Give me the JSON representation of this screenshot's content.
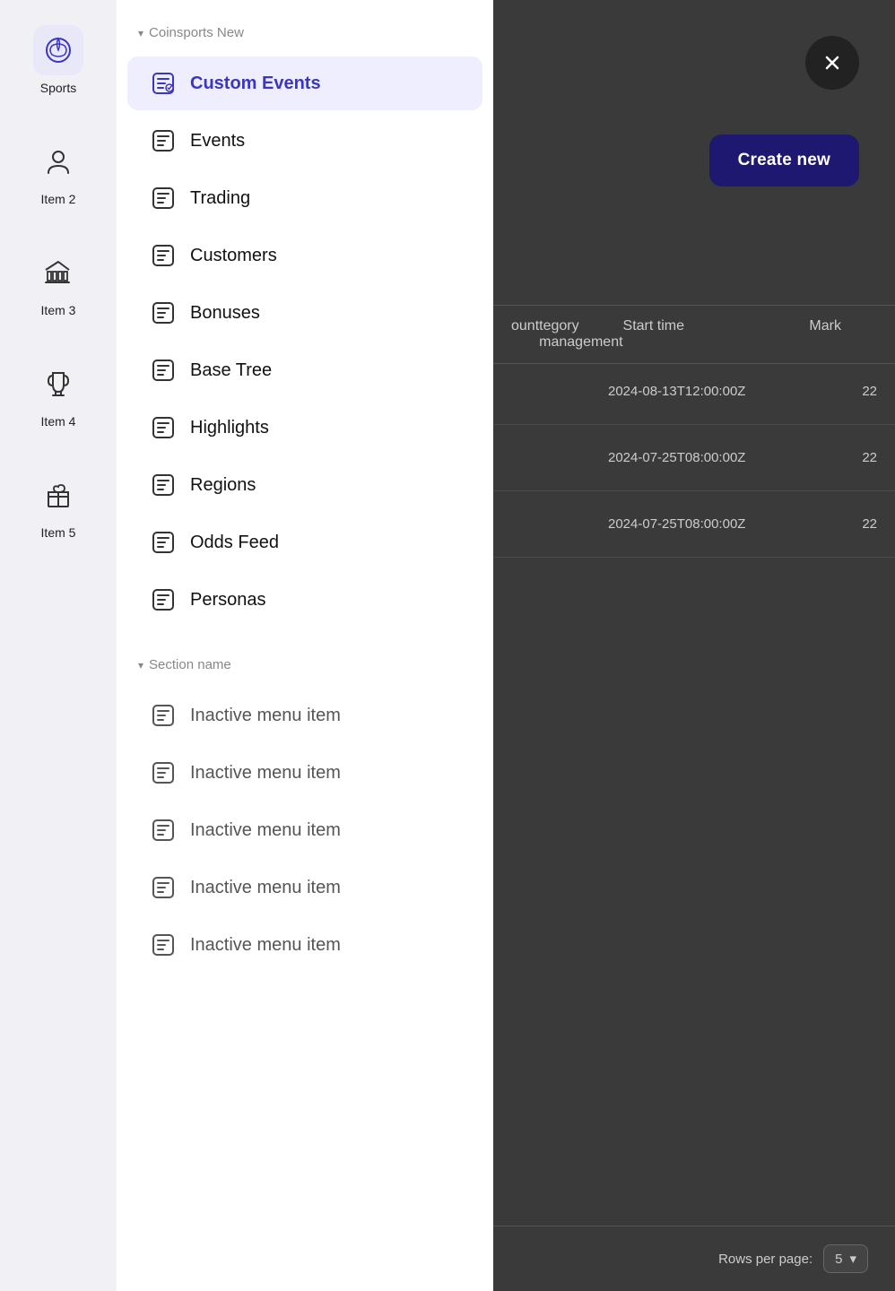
{
  "sidebar": {
    "items": [
      {
        "id": "sports",
        "label": "Sports",
        "active": true
      },
      {
        "id": "item2",
        "label": "Item 2",
        "active": false
      },
      {
        "id": "item3",
        "label": "Item 3",
        "active": false
      },
      {
        "id": "item4",
        "label": "Item 4",
        "active": false
      },
      {
        "id": "item5",
        "label": "Item 5",
        "active": false
      }
    ]
  },
  "nav": {
    "section1": {
      "header": "Coinsports New",
      "items": [
        {
          "id": "custom-events",
          "label": "Custom Events",
          "active": true
        },
        {
          "id": "events",
          "label": "Events",
          "active": false
        },
        {
          "id": "trading",
          "label": "Trading",
          "active": false
        },
        {
          "id": "customers",
          "label": "Customers",
          "active": false
        },
        {
          "id": "bonuses",
          "label": "Bonuses",
          "active": false
        },
        {
          "id": "base-tree",
          "label": "Base Tree",
          "active": false
        },
        {
          "id": "highlights",
          "label": "Highlights",
          "active": false
        },
        {
          "id": "regions",
          "label": "Regions",
          "active": false
        },
        {
          "id": "odds-feed",
          "label": "Odds Feed",
          "active": false
        },
        {
          "id": "personas",
          "label": "Personas",
          "active": false
        }
      ]
    },
    "section2": {
      "header": "Section name",
      "items": [
        {
          "id": "inactive-1",
          "label": "Inactive menu item",
          "active": false
        },
        {
          "id": "inactive-2",
          "label": "Inactive menu item",
          "active": false
        },
        {
          "id": "inactive-3",
          "label": "Inactive menu item",
          "active": false
        },
        {
          "id": "inactive-4",
          "label": "Inactive menu item",
          "active": false
        },
        {
          "id": "inactive-5",
          "label": "Inactive menu item",
          "active": false
        }
      ]
    }
  },
  "main": {
    "close_button_label": "×",
    "create_new_label": "Create new",
    "table": {
      "columns": [
        "",
        "tegory management",
        "Start time",
        "Mark"
      ],
      "rows": [
        {
          "category": "",
          "start_time": "2024-08-13T12:00:00Z",
          "mark": "22"
        },
        {
          "category": "",
          "start_time": "2024-07-25T08:00:00Z",
          "mark": "22"
        },
        {
          "category": "",
          "start_time": "2024-07-25T08:00:00Z",
          "mark": "22"
        }
      ]
    },
    "pagination": {
      "rows_per_page_label": "Rows per page:",
      "rows_per_page_value": "5"
    }
  }
}
